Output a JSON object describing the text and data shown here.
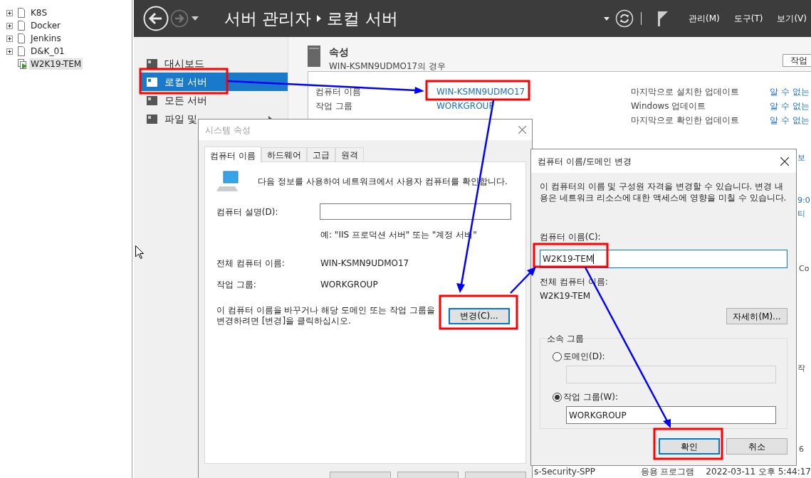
{
  "tree": {
    "items": [
      {
        "label": "K8S",
        "expandable": true,
        "selected": false,
        "kind": "vm"
      },
      {
        "label": "Docker",
        "expandable": true,
        "selected": false,
        "kind": "vm"
      },
      {
        "label": "Jenkins",
        "expandable": true,
        "selected": false,
        "kind": "vm"
      },
      {
        "label": "D&K_01",
        "expandable": true,
        "selected": false,
        "kind": "vm"
      },
      {
        "label": "W2K19-TEM",
        "expandable": false,
        "selected": true,
        "kind": "running"
      }
    ]
  },
  "server_manager": {
    "breadcrumb": [
      "서버 관리자",
      "로컬 서버"
    ],
    "menu": [
      "관리(M)",
      "도구(T)",
      "보기(V)"
    ],
    "nav": [
      {
        "label": "대시보드",
        "selected": false,
        "submenu": false
      },
      {
        "label": "로컬 서버",
        "selected": true,
        "submenu": false
      },
      {
        "label": "모든 서버",
        "selected": false,
        "submenu": false
      },
      {
        "label": "파일 및",
        "selected": false,
        "submenu": true
      }
    ],
    "properties": {
      "title": "속성",
      "subtitle": "WIN-KSMN9UDMO17의 경우",
      "task_button": "작업",
      "rows": [
        {
          "label": "컴퓨터 이름",
          "value": "WIN-KSMN9UDMO17"
        },
        {
          "label": "작업 그룹",
          "value": "WORKGROUP"
        }
      ],
      "updates": [
        {
          "label": "마지막으로 설치한 업데이트",
          "value": "알 수 없는"
        },
        {
          "label": "Windows 업데이트",
          "value": "알 수 없는"
        },
        {
          "label": "마지막으로 확인한 업데이트",
          "value": "알 수 없는"
        }
      ]
    },
    "edge_fragments": [
      "보",
      "9:0",
      "티",
      "Co",
      "작",
      "6"
    ],
    "bottom_row": [
      "s-Security-SPP",
      "응용 프로그램",
      "2022-03-11 오후 5:44:17"
    ]
  },
  "system_properties": {
    "title": "시스템 속성",
    "tabs": [
      {
        "label": "컴퓨터 이름",
        "selected": true
      },
      {
        "label": "하드웨어",
        "selected": false
      },
      {
        "label": "고급",
        "selected": false
      },
      {
        "label": "원격",
        "selected": false
      }
    ],
    "intro": "다음 정보를 사용하여 네트워크에서 사용자 컴퓨터를 확인합니다.",
    "description_label": "컴퓨터 설명(D):",
    "description_hint": "예: \"IIS 프로덕션 서버\" 또는 \"계정 서버\"",
    "full_name_label": "전체 컴퓨터 이름:",
    "full_name": "WIN-KSMN9UDMO17",
    "workgroup_label": "작업 그룹:",
    "workgroup": "WORKGROUP",
    "change_text": "이 컴퓨터 이름을 바꾸거나 해당 도메인 또는 작업 그룹을 변경하려면 [변경]을 클릭하십시오.",
    "change_button": {
      "label": "변경(C)...",
      "default": true
    }
  },
  "change_dialog": {
    "title": "컴퓨터 이름/도메인 변경",
    "description": "이 컴퓨터의 이름 및 구성원 자격을 변경할 수 있습니다. 변경 내용은 네트워크 리소스에 대한 액세스에 영향을 미칠 수 있습니다.",
    "name_label": "컴퓨터 이름(C):",
    "name_field": {
      "value": "W2K19-TEM",
      "focused": true
    },
    "full_name_label": "전체 컴퓨터 이름:",
    "full_name": "W2K19-TEM",
    "more_button": "자세히(M)...",
    "group_title": "소속 그룹",
    "membership": [
      {
        "label": "도메인(D):",
        "selected": false,
        "disabled": true
      },
      {
        "label": "작업 그룹(W):",
        "selected": true,
        "value": "WORKGROUP",
        "disabled": false
      }
    ],
    "buttons": [
      {
        "label": "확인",
        "default": true
      },
      {
        "label": "취소",
        "default": false
      }
    ]
  }
}
